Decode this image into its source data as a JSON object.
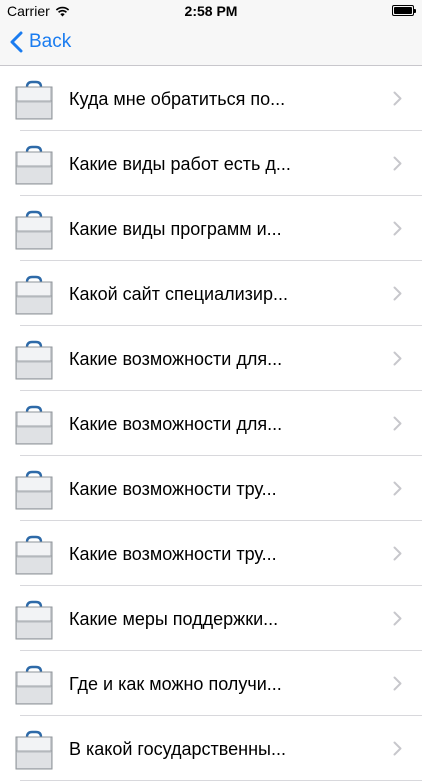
{
  "status_bar": {
    "carrier": "Carrier",
    "time": "2:58 PM"
  },
  "nav": {
    "back_label": "Back"
  },
  "colors": {
    "accent": "#1a7cf0",
    "chevron": "#c7c7cc",
    "separator": "#d8d8dc"
  },
  "items": [
    {
      "label": "Куда мне обратиться по..."
    },
    {
      "label": "Какие виды работ есть д..."
    },
    {
      "label": "Какие виды программ и..."
    },
    {
      "label": "Какой сайт специализир..."
    },
    {
      "label": "Какие возможности для..."
    },
    {
      "label": "Какие возможности для..."
    },
    {
      "label": "Какие возможности тру..."
    },
    {
      "label": "Какие возможности тру..."
    },
    {
      "label": "Какие меры поддержки..."
    },
    {
      "label": "Где и как можно получи..."
    },
    {
      "label": "В какой государственны..."
    }
  ]
}
